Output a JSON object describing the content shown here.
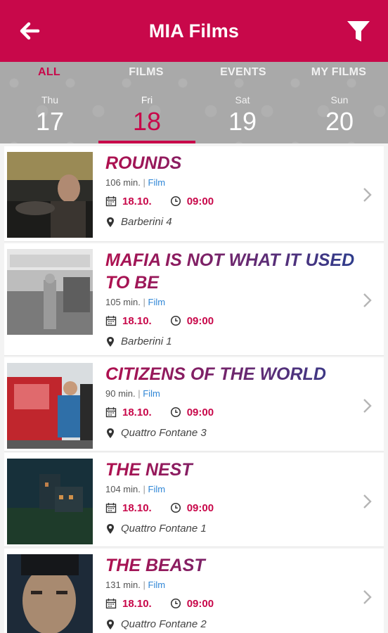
{
  "app": {
    "title": "MIA Films",
    "accent_color": "#c8084a",
    "back_icon": "arrow-left-icon",
    "filter_icon": "funnel-icon"
  },
  "tabs": [
    {
      "label": "ALL",
      "active": true
    },
    {
      "label": "FILMS",
      "active": false
    },
    {
      "label": "EVENTS",
      "active": false
    },
    {
      "label": "MY FILMS",
      "active": false
    }
  ],
  "days": [
    {
      "name": "Thu",
      "num": "17",
      "active": false
    },
    {
      "name": "Fri",
      "num": "18",
      "active": true
    },
    {
      "name": "Sat",
      "num": "19",
      "active": false
    },
    {
      "name": "Sun",
      "num": "20",
      "active": false
    }
  ],
  "films": [
    {
      "title": "ROUNDS",
      "duration": "106 min.",
      "sep": "|",
      "type": "Film",
      "date": "18.10.",
      "time": "09:00",
      "venue": "Barberini 4"
    },
    {
      "title": "MAFIA IS NOT WHAT IT USED TO BE",
      "duration": "105 min.",
      "sep": "|",
      "type": "Film",
      "date": "18.10.",
      "time": "09:00",
      "venue": "Barberini 1"
    },
    {
      "title": "CITIZENS OF THE WORLD",
      "duration": "90 min.",
      "sep": "|",
      "type": "Film",
      "date": "18.10.",
      "time": "09:00",
      "venue": "Quattro Fontane 3"
    },
    {
      "title": "THE NEST",
      "duration": "104 min.",
      "sep": "|",
      "type": "Film",
      "date": "18.10.",
      "time": "09:00",
      "venue": "Quattro Fontane 1"
    },
    {
      "title": "THE BEAST",
      "duration": "131 min.",
      "sep": "|",
      "type": "Film",
      "date": "18.10.",
      "time": "09:00",
      "venue": "Quattro Fontane 2"
    }
  ]
}
